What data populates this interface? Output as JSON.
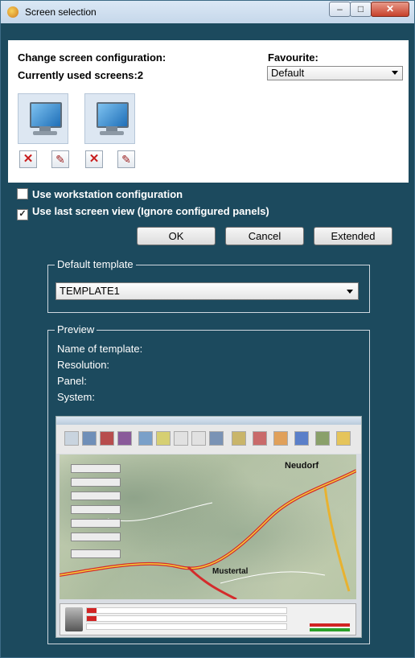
{
  "window": {
    "title": "Screen selection",
    "min_symbol": "–",
    "max_symbol": "□",
    "close_symbol": "✕"
  },
  "top": {
    "change_label": "Change screen configuration:",
    "currently_label": "Currently used screens:2",
    "favourite_label": "Favourite:",
    "favourite_value": "Default"
  },
  "screens": [
    {
      "icon": "monitor-icon"
    },
    {
      "icon": "monitor-icon"
    }
  ],
  "checkboxes": {
    "workstation": {
      "label": "Use workstation configuration",
      "checked": false
    },
    "last_view": {
      "label": "Use last screen view (Ignore configured panels)",
      "checked": true
    }
  },
  "buttons": {
    "ok": "OK",
    "cancel": "Cancel",
    "extended": "Extended"
  },
  "default_template": {
    "legend": "Default template",
    "value": "TEMPLATE1"
  },
  "preview": {
    "legend": "Preview",
    "name_label": "Name of template:",
    "resolution_label": "Resolution:",
    "panel_label": "Panel:",
    "system_label": "System:",
    "map_labels": {
      "neudorf": "Neudorf",
      "mustertal": "Mustertal"
    }
  }
}
